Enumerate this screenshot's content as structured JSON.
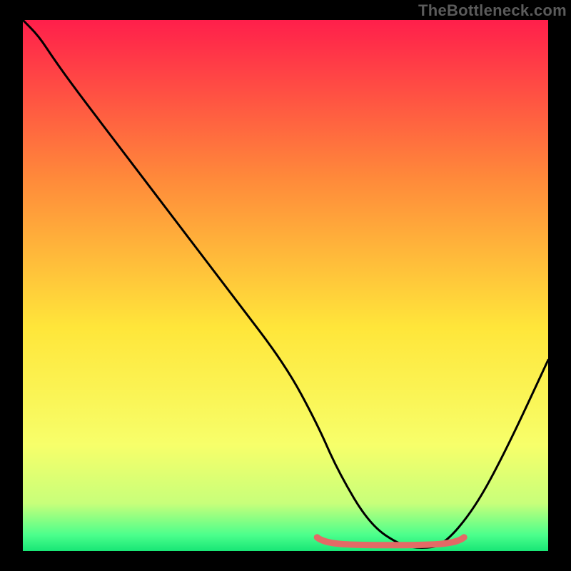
{
  "watermark": "TheBottleneck.com",
  "colors": {
    "frame": "#000000",
    "gradient_top": "#ff1f4b",
    "gradient_upper_mid": "#ff8a3a",
    "gradient_mid": "#ffe63a",
    "gradient_lower_mid": "#f7ff6a",
    "gradient_bottom1": "#c8ff7a",
    "gradient_bottom2": "#4bff8c",
    "gradient_bottom3": "#18e676",
    "curve": "#000000",
    "highlight": "#e36a66"
  },
  "chart_data": {
    "type": "line",
    "title": "",
    "xlabel": "",
    "ylabel": "",
    "xlim": [
      0,
      100
    ],
    "ylim": [
      0,
      100
    ],
    "series": [
      {
        "name": "bottleneck-curve",
        "x": [
          0,
          3,
          6,
          10,
          20,
          30,
          40,
          50,
          56,
          60,
          66,
          72,
          76,
          80,
          86,
          92,
          100
        ],
        "y": [
          100,
          97,
          92.5,
          87,
          74,
          61,
          48,
          35,
          24,
          15,
          5,
          1,
          0.5,
          1,
          8,
          19,
          36
        ]
      }
    ],
    "annotations": [
      {
        "name": "flat-bottom-highlight",
        "x_start": 56,
        "x_end": 84,
        "y": 1.5
      }
    ]
  }
}
